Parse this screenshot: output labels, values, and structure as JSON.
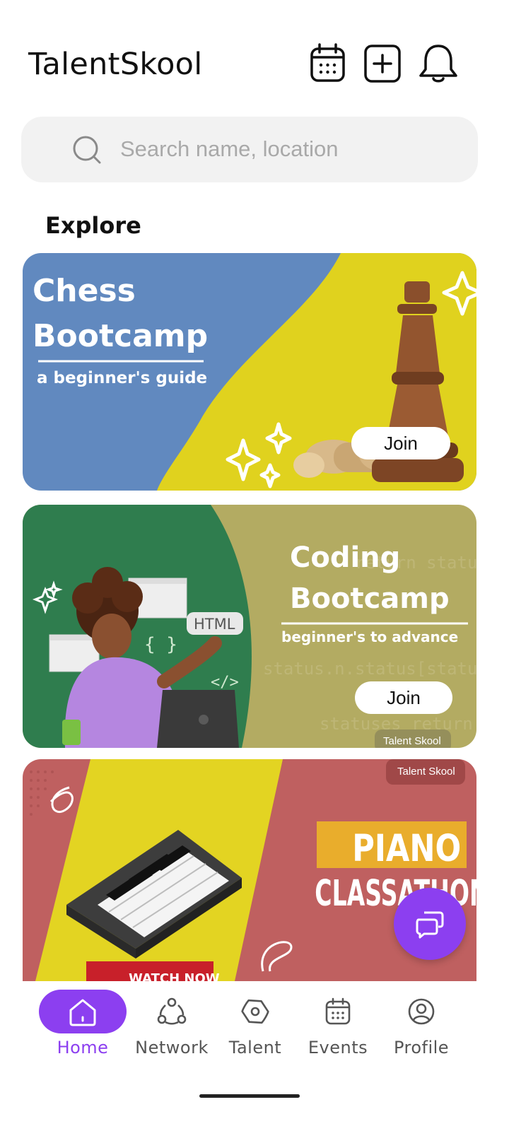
{
  "app": {
    "title": "TalentSkool"
  },
  "header": {
    "icons": [
      "calendar-icon",
      "add-icon",
      "bell-icon"
    ]
  },
  "search": {
    "placeholder": "Search name, location",
    "value": ""
  },
  "explore": {
    "title": "Explore",
    "cards": [
      {
        "title_line1": "Chess",
        "title_line2": "Bootcamp",
        "subtitle": "a beginner's guide",
        "join_label": "Join",
        "colors": {
          "left": "#6189bf",
          "right": "#e0d21e"
        }
      },
      {
        "title_line1": "Coding",
        "title_line2": "Bootcamp",
        "subtitle": "beginner's to advance",
        "join_label": "Join",
        "tag": "Talent Skool",
        "illustration_text": "HTML",
        "colors": {
          "left": "#2f7d4e",
          "right": "#b3ab62"
        }
      },
      {
        "title_line1": "PIANO",
        "title_line2": "CLASSATHON",
        "tag": "Talent Skool",
        "ribbon": "WATCH NOW",
        "colors": {
          "bg": "#bf6060",
          "stripe": "#e3d422",
          "label": "#e9ad2c"
        }
      }
    ]
  },
  "fab": {
    "icon": "chat-bubbles-icon"
  },
  "nav": {
    "active": "Home",
    "items": [
      {
        "label": "Home",
        "icon": "home-icon"
      },
      {
        "label": "Network",
        "icon": "network-icon"
      },
      {
        "label": "Talent",
        "icon": "compass-icon"
      },
      {
        "label": "Events",
        "icon": "calendar-icon"
      },
      {
        "label": "Profile",
        "icon": "profile-icon"
      }
    ]
  },
  "theme": {
    "accent": "#8c3ff0"
  }
}
